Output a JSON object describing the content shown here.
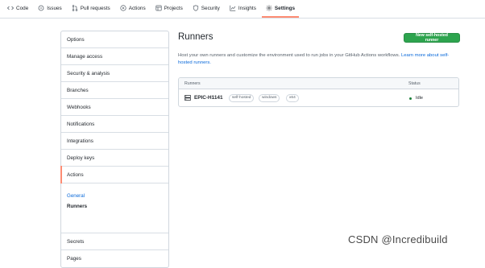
{
  "repo_nav": {
    "tabs": [
      {
        "label": "Code",
        "icon": "code-icon"
      },
      {
        "label": "Issues",
        "icon": "issue-icon"
      },
      {
        "label": "Pull requests",
        "icon": "pull-request-icon"
      },
      {
        "label": "Actions",
        "icon": "play-icon"
      },
      {
        "label": "Projects",
        "icon": "table-icon"
      },
      {
        "label": "Security",
        "icon": "shield-icon"
      },
      {
        "label": "Insights",
        "icon": "graph-icon"
      },
      {
        "label": "Settings",
        "icon": "gear-icon",
        "selected": true
      }
    ]
  },
  "sidebar": {
    "items": [
      {
        "label": "Options"
      },
      {
        "label": "Manage access"
      },
      {
        "label": "Security & analysis"
      },
      {
        "label": "Branches"
      },
      {
        "label": "Webhooks"
      },
      {
        "label": "Notifications"
      },
      {
        "label": "Integrations"
      },
      {
        "label": "Deploy keys"
      },
      {
        "label": "Actions",
        "active": true
      }
    ],
    "actions_sub": {
      "general_label": "General",
      "runners_label": "Runners"
    },
    "after": [
      {
        "label": "Secrets"
      },
      {
        "label": "Pages"
      }
    ]
  },
  "main": {
    "title": "Runners",
    "new_runner_button": "New self-hosted runner",
    "description_text": "Host your own runners and customize the environment used to run jobs in your GitHub Actions workflows.",
    "description_link": "Learn more about self-hosted runners.",
    "table": {
      "col_runners": "Runners",
      "col_status": "Status",
      "rows": [
        {
          "name": "EPIC-H1141",
          "labels": [
            "self-hosted",
            "windows",
            "x64"
          ],
          "status": "Idle",
          "status_color": "#1a7f37"
        }
      ]
    }
  },
  "watermark": "CSDN @Incredibuild",
  "colors": {
    "accent_tab": "#fd8c73",
    "button_green": "#2da44e",
    "link_blue": "#0969da"
  }
}
